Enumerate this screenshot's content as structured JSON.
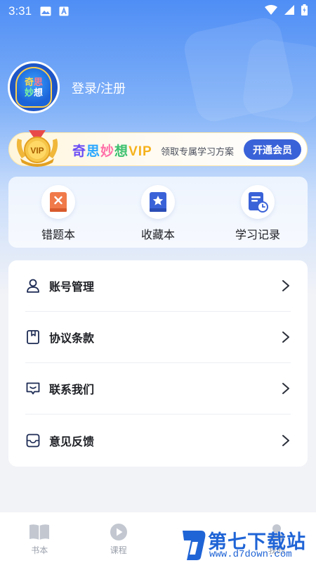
{
  "status_bar": {
    "time": "3:31"
  },
  "profile": {
    "avatar_lines": [
      [
        "奇",
        "思"
      ],
      [
        "妙",
        "想"
      ]
    ],
    "login_text": "登录/注册"
  },
  "vip": {
    "badge_text": "VIP",
    "title_chars": [
      "奇",
      "思",
      "妙",
      "想",
      "VIP"
    ],
    "description": "领取专属学习方案",
    "button_label": "开通会员"
  },
  "quick_actions": [
    {
      "label": "错题本",
      "icon": "wrong-book-icon"
    },
    {
      "label": "收藏本",
      "icon": "favorite-book-icon"
    },
    {
      "label": "学习记录",
      "icon": "study-record-icon"
    }
  ],
  "menu": [
    {
      "label": "账号管理",
      "icon": "user-icon"
    },
    {
      "label": "协议条款",
      "icon": "agreement-icon"
    },
    {
      "label": "联系我们",
      "icon": "contact-icon"
    },
    {
      "label": "意见反馈",
      "icon": "feedback-icon"
    }
  ],
  "bottom_nav": [
    {
      "label": "书本",
      "icon": "book-icon"
    },
    {
      "label": "课程",
      "icon": "play-icon"
    },
    {
      "label": "",
      "icon": "search-icon"
    },
    {
      "label": "我的",
      "icon": "profile-icon"
    }
  ],
  "watermark": {
    "title": "第七下载站",
    "url": "www.d7down.com"
  },
  "colors": {
    "accent": "#3a62d8",
    "hero_top": "#4f8ef5",
    "background": "#f2f3f7"
  }
}
